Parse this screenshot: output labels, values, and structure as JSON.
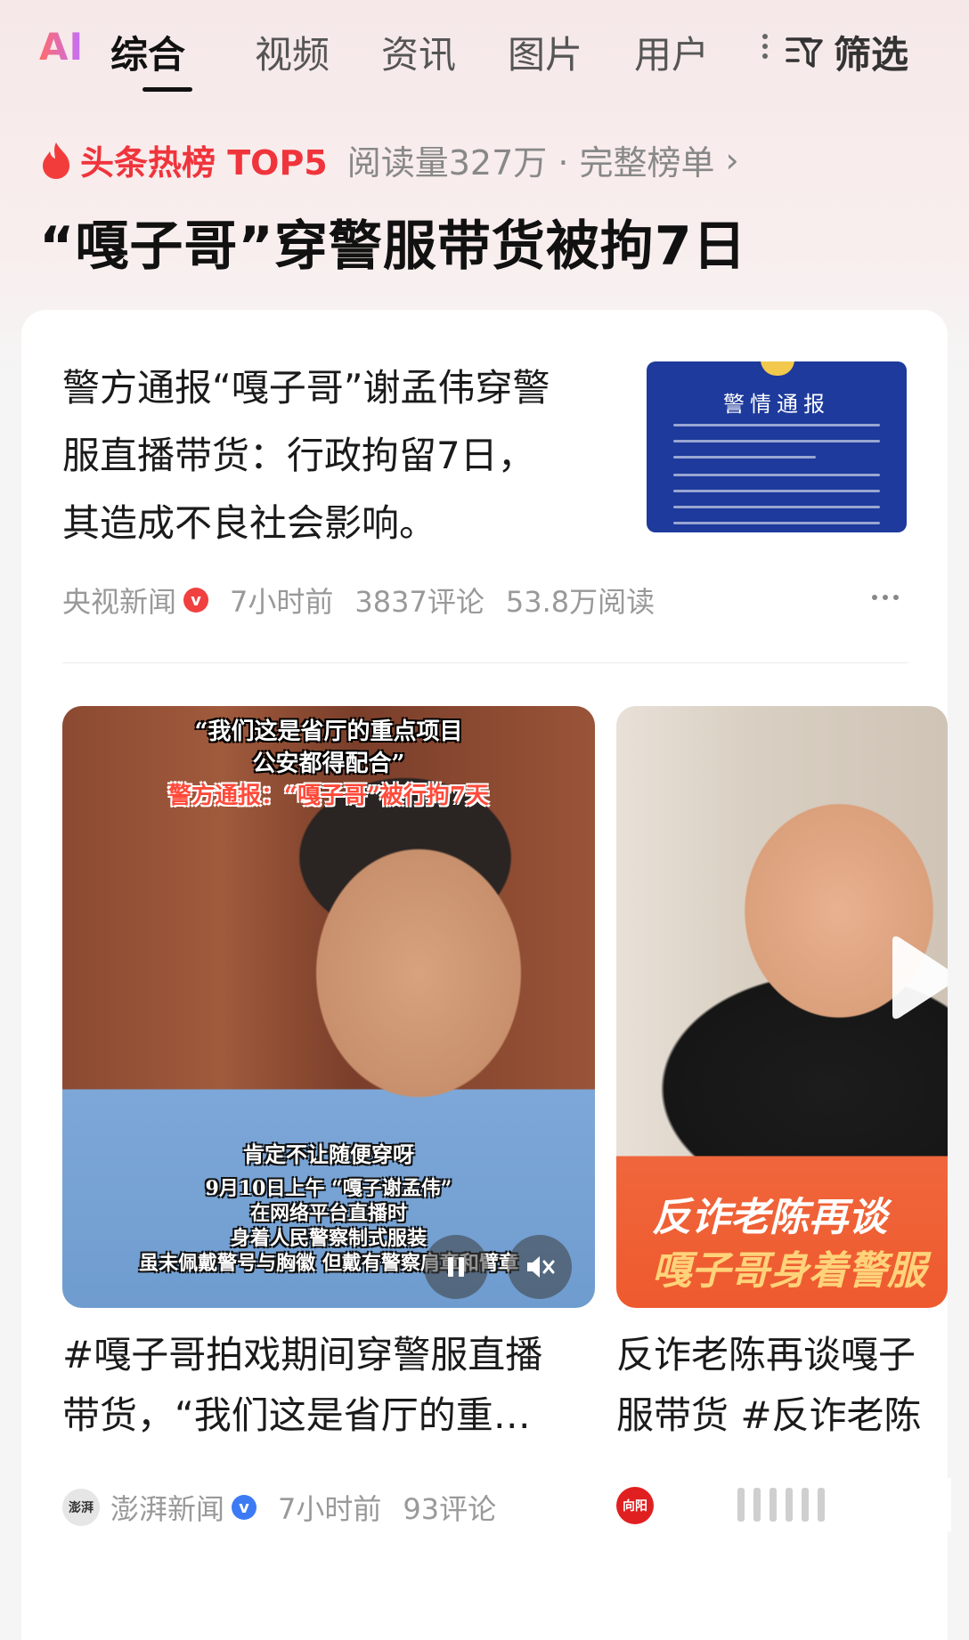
{
  "tabs": {
    "ai_label": "AI",
    "items": [
      {
        "label": "综合",
        "active": true
      },
      {
        "label": "视频",
        "active": false
      },
      {
        "label": "资讯",
        "active": false
      },
      {
        "label": "图片",
        "active": false
      },
      {
        "label": "用户",
        "active": false
      }
    ],
    "filter_label": "筛选"
  },
  "hot": {
    "title": "头条热榜 TOP5",
    "meta": "阅读量327万 · 完整榜单",
    "chevron": "›",
    "headline": "“嘎子哥”穿警服带货被拘7日"
  },
  "article": {
    "title": "警方通报“嘎子哥”谢孟伟穿警服直播带货：行政拘留7日，其造成不良社会影响。",
    "title_lines": [
      "警方通报“嘎子哥”谢孟伟穿警",
      "服直播带货：行政拘留7日，",
      "其造成不良社会影响。"
    ],
    "thumb_heading": "警情通报",
    "source": "央视新闻",
    "verified_mark": "v",
    "time": "7小时前",
    "comments": "3837评论",
    "reads": "53.8万阅读"
  },
  "video1": {
    "cap_line1": "“我们这是省厅的重点项目",
    "cap_line2": "公安都得配合”",
    "cap_line3": "警方通报：“嘎子哥”被行拘7天",
    "sub_line1": "肯定不让随便穿呀",
    "sub_line2": "9月10日上午 “嘎子谢孟伟”",
    "sub_line3": "在网络平台直播时",
    "sub_line4": "身着人民警察制式服装",
    "sub_line5": "虽未佩戴警号与胸徽 但戴有警察肩章和臂章",
    "title_line1": "#嘎子哥拍戏期间穿警服直播",
    "title_line2": "带货，“我们这是省厅的重…",
    "avatar_text": "澎湃",
    "source": "澎湃新闻",
    "verified_mark": "v",
    "time": "7小时前",
    "comments": "93评论"
  },
  "video2": {
    "cap_line1": "反诈老陈再谈",
    "cap_line2": "嘎子哥身着警服",
    "title_line1": "反诈老陈再谈嘎子",
    "title_line2": "服带货 #反诈老陈",
    "avatar_text": "向阳"
  }
}
